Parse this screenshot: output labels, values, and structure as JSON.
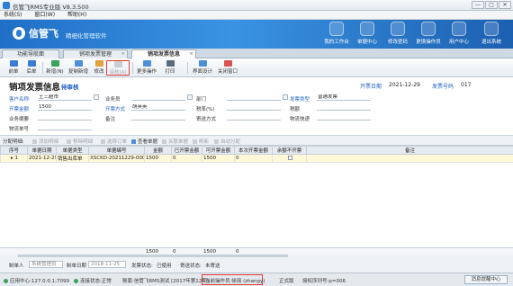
{
  "window": {
    "title": "信管飞RMS专业版 V8.3.500",
    "buttons": [
      "—",
      "□",
      "✕"
    ]
  },
  "menu": [
    "系统(S)",
    "窗口(W)",
    "帮助(H)"
  ],
  "banner": {
    "logo": "信管飞",
    "slogan": "精细化管理软件",
    "shortcuts": [
      {
        "label": "我的工作台",
        "icon": "workbench-icon"
      },
      {
        "label": "单据中心",
        "icon": "documents-icon"
      },
      {
        "label": "修改密码",
        "icon": "key-icon"
      },
      {
        "label": "更换操作员",
        "icon": "switch-user-icon"
      },
      {
        "label": "用户中心",
        "icon": "user-center-icon"
      },
      {
        "label": "退出系统",
        "icon": "power-icon"
      }
    ]
  },
  "doc_tabs": [
    {
      "label": "功能导航面",
      "active": false
    },
    {
      "label": "销项发票管理",
      "active": false
    },
    {
      "label": "销项发票信息",
      "active": true
    }
  ],
  "toolbar": [
    {
      "label": "前单",
      "icon": "arrow-left-icon",
      "color": "#3a7bd5",
      "disabled": false
    },
    {
      "label": "后单",
      "icon": "arrow-right-icon",
      "color": "#3a7bd5",
      "disabled": false
    },
    {
      "label": "新增(N)",
      "icon": "new-doc-icon",
      "color": "#3aa35b",
      "disabled": false
    },
    {
      "label": "复制新增",
      "icon": "copy-icon",
      "color": "#4d8fd6",
      "disabled": false
    },
    {
      "label": "修改",
      "icon": "edit-icon",
      "color": "#e0a23a",
      "disabled": false
    },
    {
      "label": "审核(A)",
      "icon": "audit-icon",
      "color": "#8aa0b6",
      "disabled": true
    },
    {
      "label": "更多操作",
      "icon": "more-icon",
      "color": "#4d8fd6",
      "disabled": false
    },
    {
      "label": "打印",
      "icon": "printer-icon",
      "color": "#5a6b7c",
      "disabled": false
    },
    {
      "label": "界面设计",
      "icon": "design-icon",
      "color": "#4d8fd6",
      "disabled": false
    },
    {
      "label": "关闭窗口",
      "icon": "close-window-icon",
      "color": "#d9534f",
      "disabled": false
    }
  ],
  "form": {
    "title": "销项发票信息",
    "status": "待审核",
    "date_label": "开票日期",
    "date_value": "2021-12-29",
    "no_label": "发票号码",
    "no_value": "017",
    "fields": {
      "client_name_label": "客户名称",
      "client_name": "王三超市",
      "salesperson_label": "业务员",
      "salesperson": "",
      "dept_label": "部门",
      "dept": "",
      "invoice_type_label": "发票类型",
      "invoice_type": "普通发票",
      "amount_label": "开票金额",
      "amount": "1500",
      "drawer_label": "开票方式",
      "drawer": "胡英英",
      "tax_no_label": "税率(%)",
      "tax_no": "",
      "tax_label": "税额",
      "tax": "",
      "contact_label": "业务摘要",
      "contact": "",
      "remark_label": "备注",
      "remark": "",
      "ship_label": "寄送方式",
      "ship": "",
      "express_label": "物流快递",
      "express": "",
      "track_label": "物流单号",
      "track": ""
    }
  },
  "detail": {
    "title": "分配明细:",
    "buttons": [
      {
        "label": "添加明细",
        "enabled": false
      },
      {
        "label": "移除明细",
        "enabled": false
      },
      {
        "label": "选择订单",
        "enabled": false
      },
      {
        "label": "查看单据",
        "enabled": true
      },
      {
        "label": "关联单据",
        "enabled": false
      },
      {
        "label": "刷新",
        "enabled": false
      },
      {
        "label": "自动分配",
        "enabled": false
      }
    ],
    "columns": [
      "序号",
      "单据日期",
      "单据类型",
      "单据编号",
      "金额",
      "已开票金额",
      "可开票金额",
      "本次开票金额",
      "余额不开票",
      "备注"
    ],
    "rows": [
      [
        "1",
        "2021-12-29",
        "销售出库单",
        "XSCKD-20211229-0003",
        "1500",
        "0",
        "1500",
        "0",
        "",
        ""
      ]
    ],
    "sums": {
      "amount": "1500",
      "invoiced": "0",
      "available": "1500",
      "current": "0"
    }
  },
  "footer": {
    "maker_label": "制单人",
    "maker": "系统管理员",
    "made_date_label": "制单日期",
    "made_date": "2018-11-25",
    "invoice_status_label": "发票状态:",
    "invoice_status": "已使用",
    "send_status_label": "寄送状态:",
    "send_status": "未寄送"
  },
  "statusbar": {
    "server_label": "应用中心:",
    "server": "127.0.0.1:7099",
    "conn_label": "连接状态:",
    "conn": "正常",
    "account_label": "账套:",
    "account": "信管飞RMS测试 [2017年第12期]",
    "operator_label": "当前操作员:",
    "operator": "徐丽 (zhangy)",
    "version": "正式版",
    "serial_label": "授权序列号:",
    "serial": "p=006",
    "msg_btn": "消息提醒中心"
  }
}
